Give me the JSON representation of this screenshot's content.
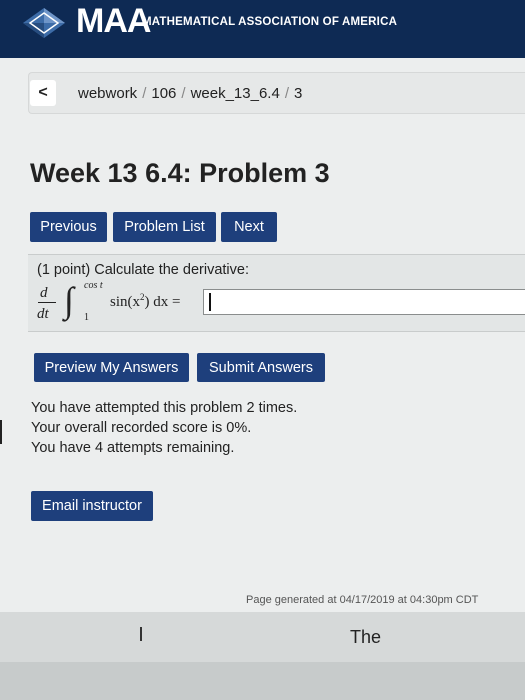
{
  "header": {
    "logo_text": "MAA",
    "org_name": "MATHEMATICAL ASSOCIATION OF AMERICA",
    "logo_icon": "diamond-logo-icon",
    "background_color": "#0e2a54"
  },
  "breadcrumb": {
    "back_icon": "chevron-left-icon",
    "back_label": "<",
    "items": [
      "webwork",
      "106",
      "week_13_6.4",
      "3"
    ],
    "separator": "/"
  },
  "page": {
    "title": "Week 13 6.4: Problem 3"
  },
  "nav_buttons": {
    "previous": "Previous",
    "problem_list": "Problem List",
    "next": "Next"
  },
  "problem": {
    "prompt": "(1 point) Calculate the derivative:",
    "derivative_numerator": "d",
    "derivative_denominator": "dt",
    "upper_limit": "cos t",
    "lower_limit": "1",
    "integrand": "sin(x",
    "exponent": "2",
    "integrand_end": ") dx =",
    "answer_value": ""
  },
  "actions": {
    "preview": "Preview My Answers",
    "submit": "Submit Answers"
  },
  "attempts": {
    "line1": "You have attempted this problem 2 times.",
    "line2": "Your overall recorded score is 0%.",
    "line3": "You have 4 attempts remaining."
  },
  "email_button": "Email instructor",
  "footer": {
    "generated": "Page generated at 04/17/2019 at 04:30pm CDT"
  },
  "bottom": {
    "cursor_mark": "I",
    "text": "The"
  },
  "colors": {
    "button": "#1e3f7c",
    "header": "#0e2a54"
  }
}
